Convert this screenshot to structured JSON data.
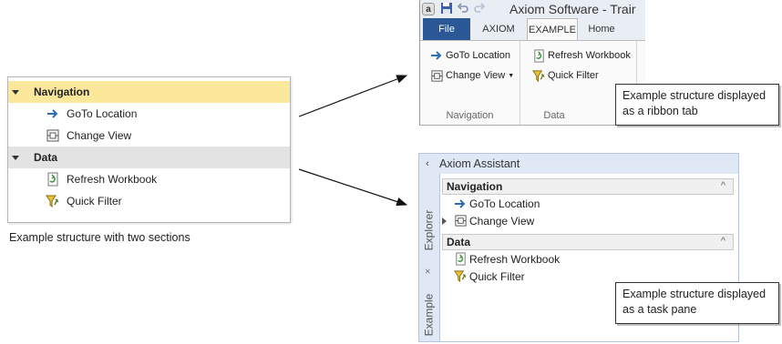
{
  "structure": {
    "sections": [
      {
        "title": "Navigation",
        "items": [
          {
            "label": "GoTo Location",
            "icon": "arrow-right-icon"
          },
          {
            "label": "Change View",
            "icon": "change-view-icon"
          }
        ]
      },
      {
        "title": "Data",
        "items": [
          {
            "label": "Refresh Workbook",
            "icon": "refresh-workbook-icon"
          },
          {
            "label": "Quick Filter",
            "icon": "quick-filter-icon"
          }
        ]
      }
    ],
    "caption": "Example structure with two sections"
  },
  "ribbon": {
    "app_logo": "a",
    "title": "Axiom Software - Trair",
    "tabs": [
      "File",
      "AXIOM",
      "EXAMPLE",
      "Home"
    ],
    "groups": [
      {
        "label": "Navigation",
        "buttons": [
          "GoTo Location",
          "Change View"
        ]
      },
      {
        "label": "Data",
        "buttons": [
          "Refresh Workbook",
          "Quick Filter"
        ]
      }
    ],
    "callout": "Example structure displayed as a ribbon tab"
  },
  "task_pane": {
    "title": "Axiom Assistant",
    "collapse_glyph": "‹",
    "vertical_tabs": [
      "Explorer",
      "Example"
    ],
    "close_glyph": "×",
    "sections": [
      {
        "title": "Navigation",
        "chevron": "^",
        "items": [
          "GoTo Location",
          "Change View"
        ]
      },
      {
        "title": "Data",
        "chevron": "^",
        "items": [
          "Refresh Workbook",
          "Quick Filter"
        ]
      }
    ],
    "callout": "Example structure displayed as a task pane"
  },
  "colors": {
    "nav_header": "#fbe89a",
    "data_header": "#e3e3e3",
    "file_tab": "#2b5797",
    "arrow_blue": "#2e6db4",
    "pane_bg": "#dfe8f4"
  }
}
